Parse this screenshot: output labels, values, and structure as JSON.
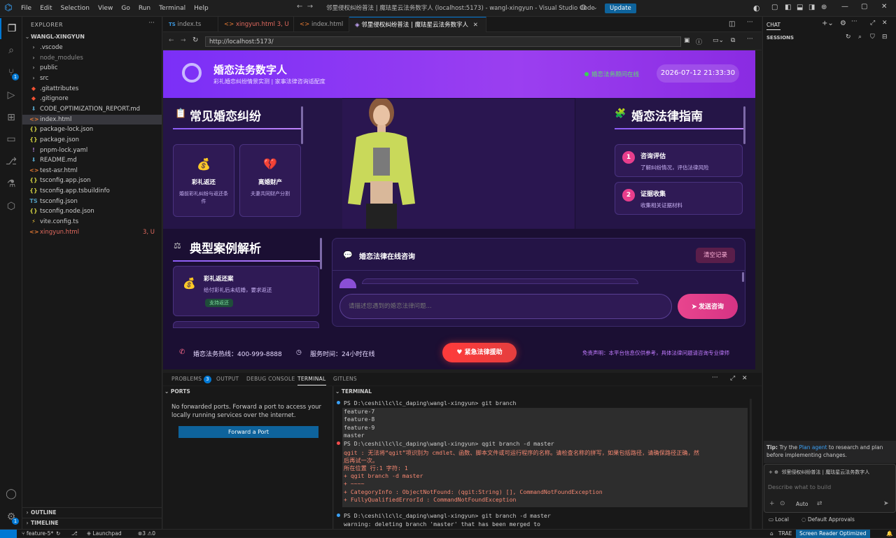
{
  "titlebar": {
    "menu": [
      "File",
      "Edit",
      "Selection",
      "View",
      "Go",
      "Run",
      "Terminal",
      "Help"
    ],
    "window_title": "邻里侵权纠纷普法 | 魔珐星云法务数字人 (localhost:5173) - wangl-xingyun - Visual Studio Code",
    "update_label": "Update"
  },
  "explorer": {
    "header": "EXPLORER",
    "root": "WANGL-XINGYUN",
    "items": [
      {
        "label": ".vscode",
        "type": "folder"
      },
      {
        "label": "node_modules",
        "type": "folder"
      },
      {
        "label": "public",
        "type": "folder"
      },
      {
        "label": "src",
        "type": "folder"
      },
      {
        "label": ".gitattributes",
        "type": "git"
      },
      {
        "label": ".gitignore",
        "type": "git"
      },
      {
        "label": "CODE_OPTIMIZATION_REPORT.md",
        "type": "md"
      },
      {
        "label": "index.html",
        "type": "html"
      },
      {
        "label": "package-lock.json",
        "type": "json"
      },
      {
        "label": "package.json",
        "type": "json"
      },
      {
        "label": "pnpm-lock.yaml",
        "type": "yaml"
      },
      {
        "label": "README.md",
        "type": "md"
      },
      {
        "label": "test-asr.html",
        "type": "html"
      },
      {
        "label": "tsconfig.app.json",
        "type": "json"
      },
      {
        "label": "tsconfig.app.tsbuildinfo",
        "type": "json"
      },
      {
        "label": "tsconfig.json",
        "type": "ts"
      },
      {
        "label": "tsconfig.node.json",
        "type": "json"
      },
      {
        "label": "vite.config.ts",
        "type": "vite"
      },
      {
        "label": "xingyun.html",
        "type": "html"
      }
    ],
    "xingyun_status": "3, U",
    "outline": "OUTLINE",
    "timeline": "TIMELINE"
  },
  "tabs": [
    {
      "label": "index.ts",
      "icon": "TS"
    },
    {
      "label": "xingyun.html",
      "status": "3, U"
    },
    {
      "label": "index.html"
    },
    {
      "label": "邻里侵权纠纷普法 | 魔珐星云法务数字人"
    }
  ],
  "browser": {
    "url": "http://localhost:5173/"
  },
  "web": {
    "title": "婚恋法务数字人",
    "subtitle": "彩礼婚恋纠纷情景实测 | 家事法律咨询适配度",
    "online": "婚恋法务顾问在线",
    "datetime": "2026-07-12 21:33:30",
    "disputes_title": "常见婚恋纠纷",
    "disputes": [
      {
        "title": "彩礼返还",
        "desc": "婚前彩礼纠纷与返还条件"
      },
      {
        "title": "离婚财产",
        "desc": "夫妻共同财产分割"
      }
    ],
    "guide_title": "婚恋法律指南",
    "steps": [
      {
        "num": "1",
        "title": "咨询评估",
        "desc": "了解纠纷情况，评估法律风险"
      },
      {
        "num": "2",
        "title": "证据收集",
        "desc": "收集相关证据材料"
      }
    ],
    "cases_title": "典型案例解析",
    "case": {
      "title": "彩礼返还案",
      "desc": "给付彩礼后未结婚，要求返还",
      "tag": "支持返还"
    },
    "chat_title": "婚恋法律在线咨询",
    "clear_label": "清空记录",
    "chat_placeholder": "请描述您遇到的婚恋法律问题...",
    "send_label": "发送咨询",
    "hotline": "婚恋法务热线：400-999-8888",
    "service_time": "服务时间：24小时在线",
    "urgent_label": "紧急法律援助",
    "disclaimer": "免责声明：本平台信息仅供参考，具体法律问题请咨询专业律师"
  },
  "panel": {
    "tabs": [
      "PROBLEMS",
      "OUTPUT",
      "DEBUG CONSOLE",
      "TERMINAL",
      "GITLENS"
    ],
    "problems_count": "3",
    "ports_header": "PORTS",
    "ports_msg": "No forwarded ports. Forward a port to access your locally running services over the internet.",
    "forward_btn": "Forward a Port",
    "terminal_header": "TERMINAL",
    "terminal_lines": [
      {
        "text": "PS D:\\ceshi\\lc\\lc_daping\\wangl-xingyun> git branch",
        "kind": "cmd"
      },
      {
        "text": "  feature-7",
        "kind": "out"
      },
      {
        "text": "  feature-8",
        "kind": "out"
      },
      {
        "text": "  feature-9",
        "kind": "out"
      },
      {
        "text": "  master",
        "kind": "out"
      },
      {
        "text": "PS D:\\ceshi\\lc\\lc_daping\\wangl-xingyun> qgit branch -d master",
        "kind": "cmd"
      },
      {
        "text": "qgit : 无法将“qgit”项识别为 cmdlet、函数、脚本文件或可运行程序的名称。请检查名称的拼写，如果包括路径，请确保路径正确，然",
        "kind": "err"
      },
      {
        "text": "后再试一次。",
        "kind": "err"
      },
      {
        "text": "所在位置 行:1 字符: 1",
        "kind": "err"
      },
      {
        "text": "+ qgit branch -d master",
        "kind": "err"
      },
      {
        "text": "+ ~~~~",
        "kind": "err"
      },
      {
        "text": "    + CategoryInfo          : ObjectNotFound: (qgit:String) [], CommandNotFoundException",
        "kind": "err"
      },
      {
        "text": "    + FullyQualifiedErrorId : CommandNotFoundException",
        "kind": "err"
      },
      {
        "text": "",
        "kind": "out"
      },
      {
        "text": "PS D:\\ceshi\\lc\\lc_daping\\wangl-xingyun> git branch -d master",
        "kind": "cmd"
      },
      {
        "text": "warning: deleting branch 'master' that has been merged to",
        "kind": "out"
      }
    ]
  },
  "chat": {
    "header": "CHAT",
    "sessions": "SESSIONS",
    "tip_prefix": "Tip:",
    "tip_text": " Try the ",
    "tip_link": "Plan agent",
    "tip_rest": " to research and plan before implementing changes.",
    "context_chip": "邻里侵权纠纷普法 | 魔珐星云法务数字人",
    "input_placeholder": "Describe what to build",
    "mode": "Auto",
    "local": "Local",
    "approvals": "Default Approvals"
  },
  "status": {
    "branch": "feature-5*",
    "launchpad": "Launchpad",
    "errors": "3",
    "warnings": "0",
    "trae": "TRAE",
    "screen_reader": "Screen Reader Optimized"
  }
}
